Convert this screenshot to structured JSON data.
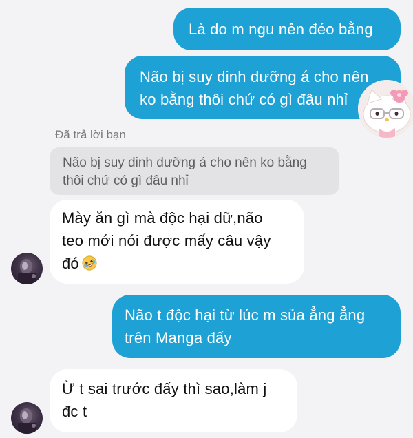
{
  "messages": {
    "sent_1": "Là do m ngu nên đéo bằng",
    "sent_2_line1": "Não bị suy dinh dưỡng á cho nên",
    "sent_2_line2": "ko bằng thôi chứ có gì đâu nhỉ",
    "reply_label": "Đã trả lời bạn",
    "reply_quote_line1": "Não bị suy dinh dưỡng á cho nên ko bằng",
    "reply_quote_line2": "thôi chứ có gì đâu nhỉ",
    "recv_1_line1": "Mày ăn gì mà độc hại dữ,não",
    "recv_1_line2": "teo mới nói được mấy câu vậy",
    "recv_1_line3": "đó",
    "sent_3_line1": "Não t độc hại từ lúc m sủa ẳng ẳng",
    "sent_3_line2": "trên Manga đấy",
    "recv_2_line1": "Ừ t sai trước đấy thì sao,làm j",
    "recv_2_line2": "đc t"
  },
  "icons": {
    "reaction_emoji": "rolling-on-floor-laughing-emoji",
    "sticker": "hello-kitty-sticker",
    "avatar": "contact-avatar"
  },
  "colors": {
    "sent_bubble": "#1ea2d6",
    "received_bubble": "#ffffff",
    "quote_bubble": "#e3e3e6",
    "background": "#f3f3f5"
  }
}
